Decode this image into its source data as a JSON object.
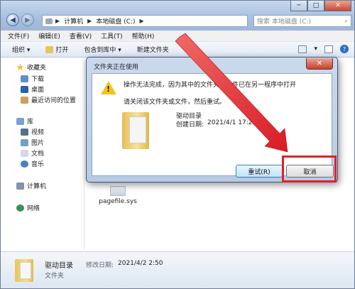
{
  "window": {
    "controls": {
      "minimize": "─",
      "maximize": "□",
      "close": "✕"
    },
    "breadcrumb": [
      "计算机",
      "本地磁盘 (C:)"
    ],
    "search_placeholder": "搜索 本地磁盘 (C:)"
  },
  "menu": [
    "文件(F)",
    "编辑(E)",
    "查看(V)",
    "工具(T)",
    "帮助(H)"
  ],
  "toolbar": {
    "organize": "组织 ▾",
    "open": "打开",
    "include_library": "包含到库中 ▾",
    "new_folder": "新建文件夹"
  },
  "sidebar": {
    "favorites": "收藏夹",
    "downloads": "下载",
    "desktop": "桌面",
    "recent": "最近访问的位置",
    "libraries": "库",
    "videos": "视频",
    "pictures": "图片",
    "documents": "文档",
    "music": "音乐",
    "computer": "计算机",
    "network": "网络"
  },
  "main": {
    "file_name": "pagefile.sys"
  },
  "details": {
    "name": "驱动目录",
    "modified_label": "修改日期:",
    "modified_value": "2021/4/2 2:50",
    "type": "文件夹"
  },
  "dialog": {
    "title": "文件夹正在使用",
    "close": "✕",
    "message": "操作无法完成，因为其中的文件夹或文件已在另一程序中打开",
    "hint": "请关闭该文件夹或文件，然后重试。",
    "item_name": "驱动目录",
    "created_label": "创建日期:",
    "created_value": "2021/4/1 17:22",
    "retry": "重试(R)",
    "cancel": "取消"
  },
  "colors": {
    "highlight": "#e0202d",
    "arrow": "#e0202d"
  }
}
